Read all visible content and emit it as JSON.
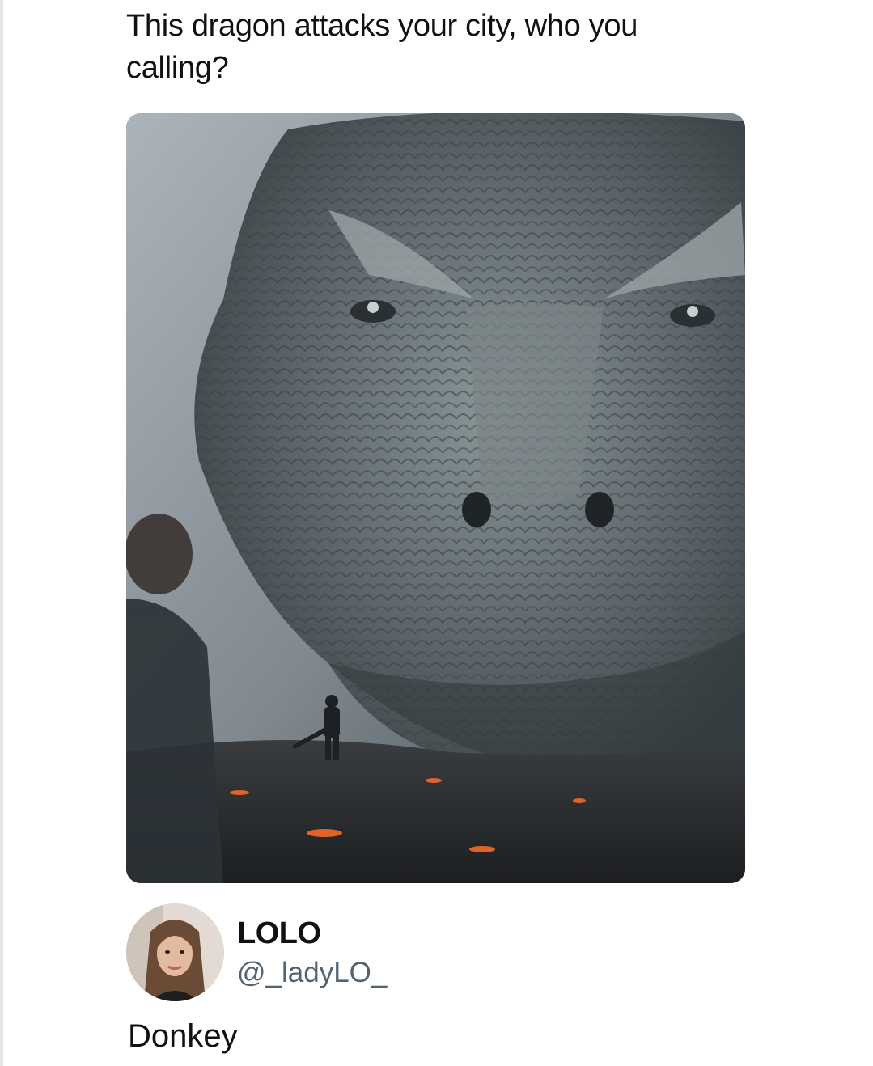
{
  "post": {
    "text_line1": "This dragon attacks your city, who you",
    "text_line2": "calling?",
    "media": {
      "description_icon": "dragon-image"
    }
  },
  "reply": {
    "display_name": "LOLO",
    "handle": "@_ladyLO_",
    "text": "Donkey"
  },
  "colors": {
    "background": "#ffffff",
    "text": "#111111",
    "handle": "#536471"
  }
}
